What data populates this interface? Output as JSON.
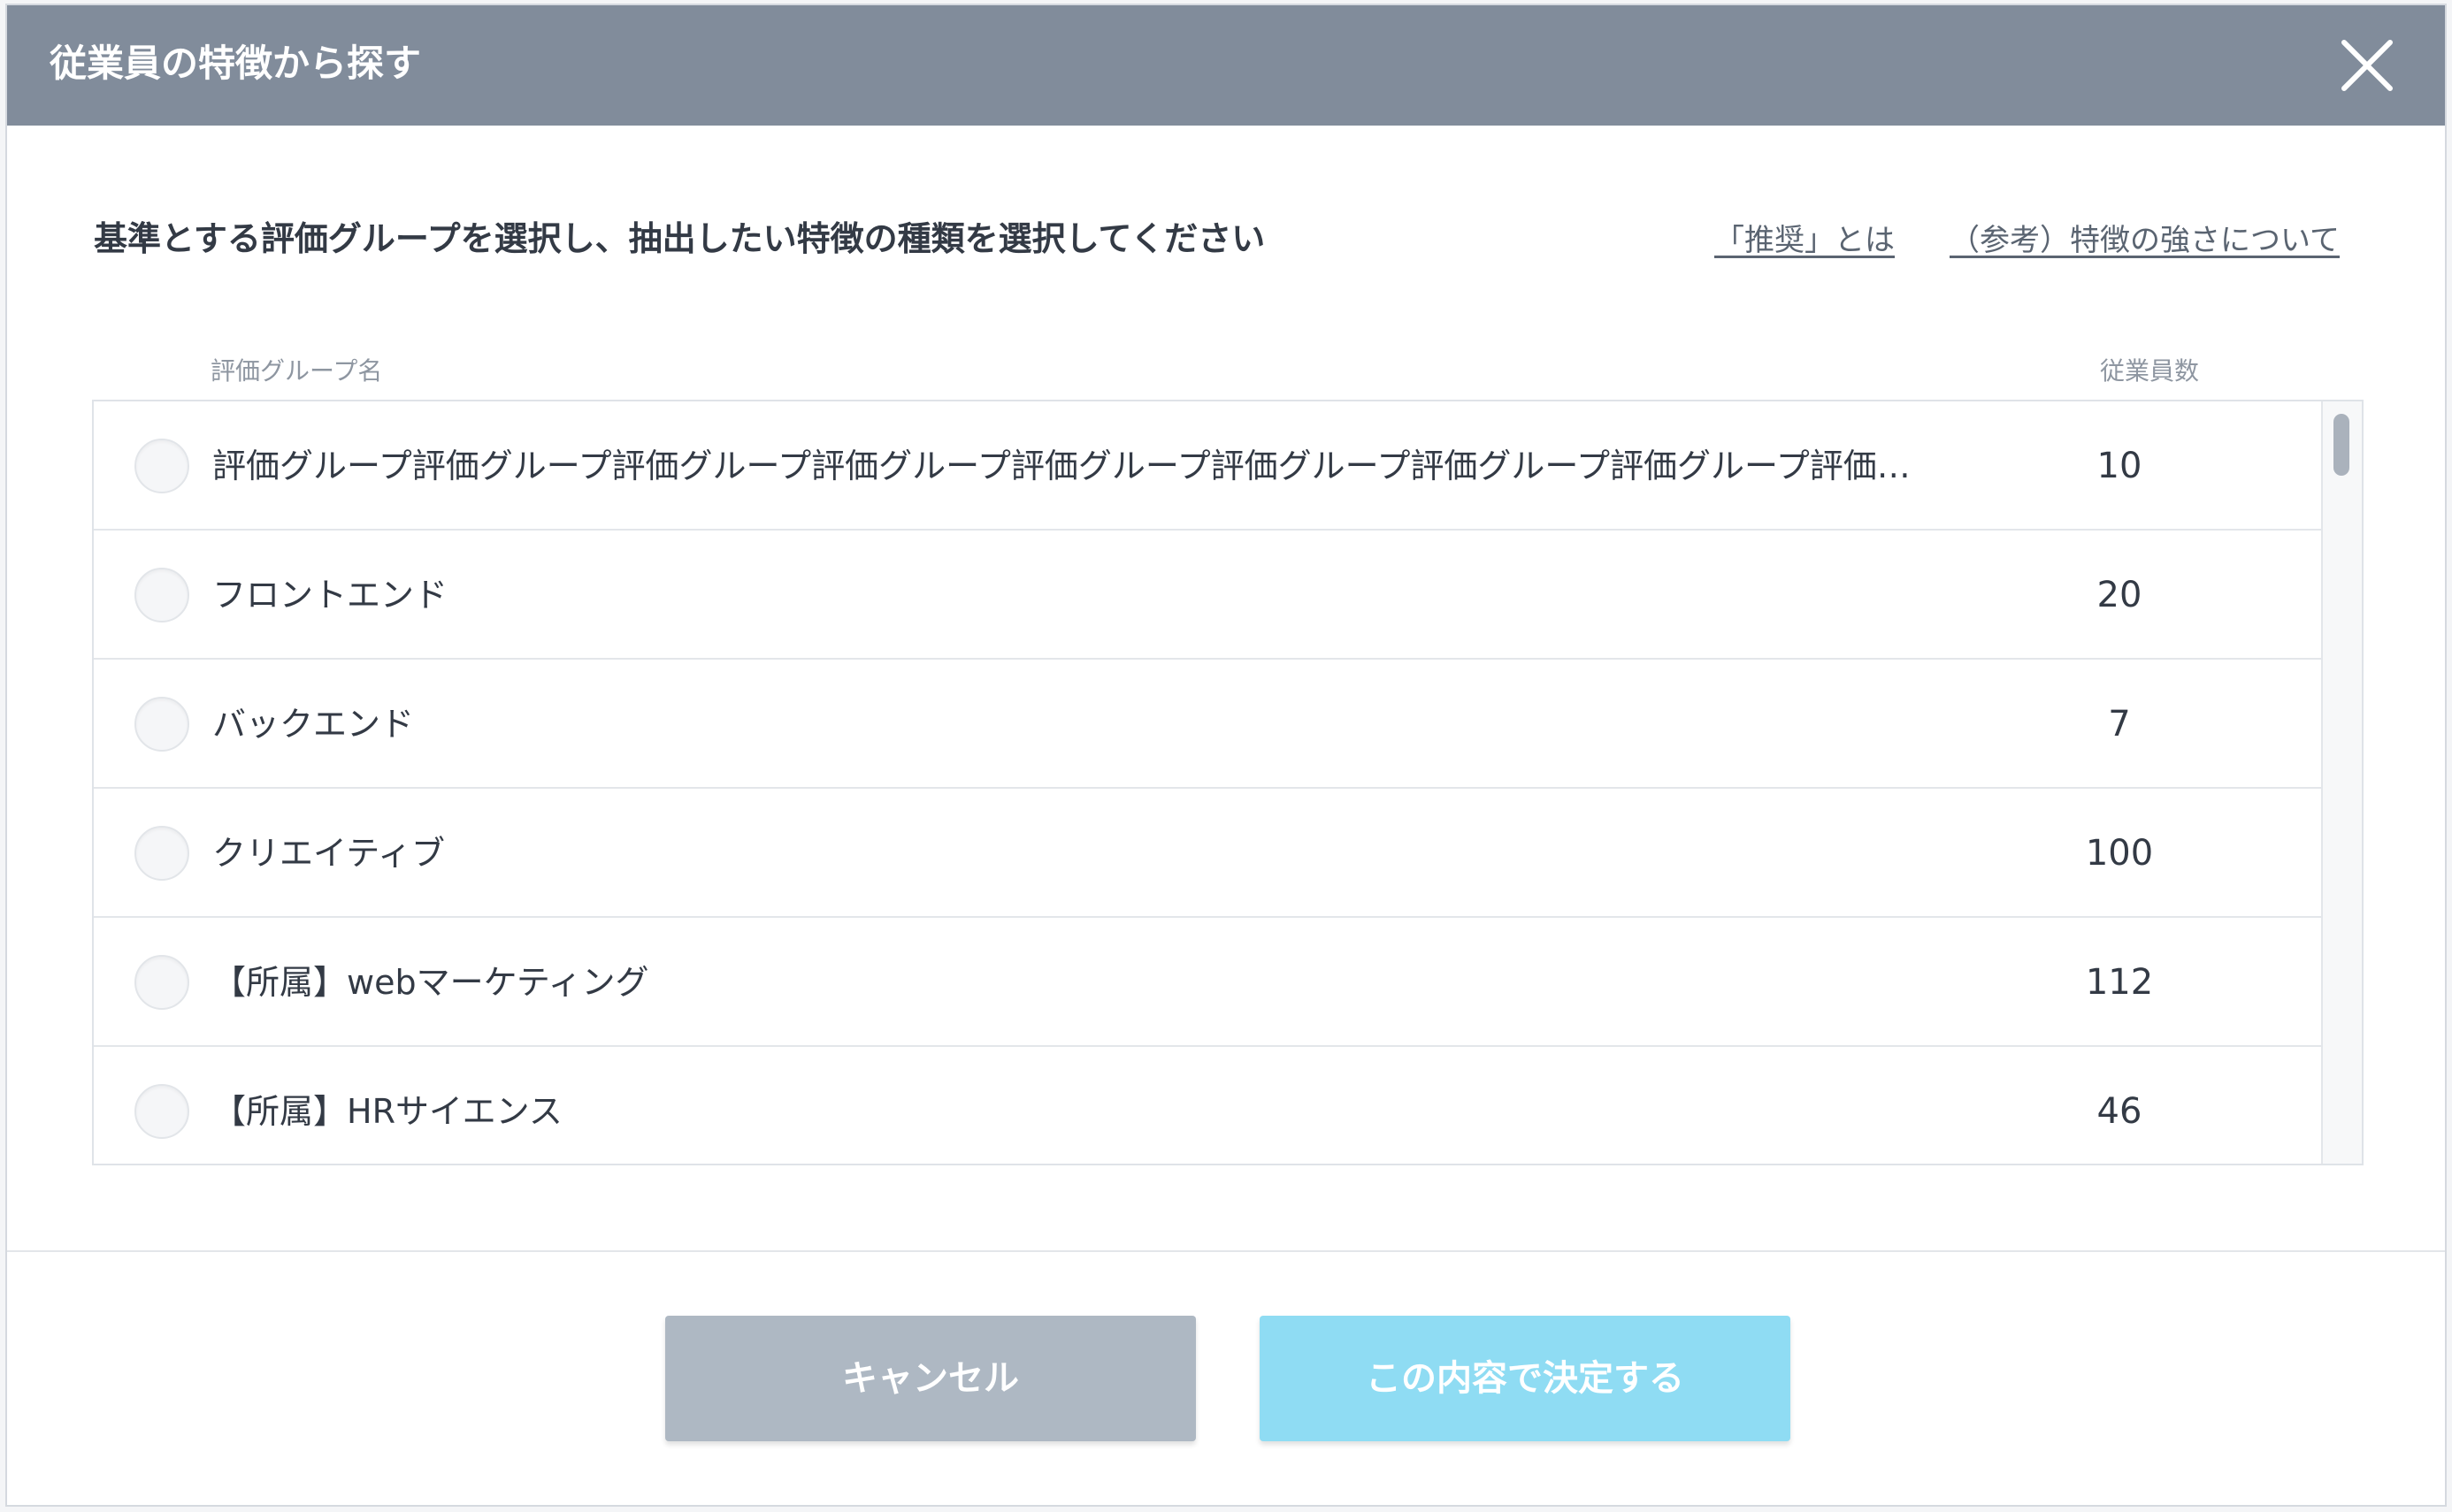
{
  "header": {
    "title": "従業員の特徴から探す",
    "close_icon": "close-icon"
  },
  "instruction": "基準とする評価グループを選択し、抽出したい特徴の種類を選択してください",
  "links": {
    "recommended": "「推奨」とは",
    "reference": "（参考）特徴の強さについて"
  },
  "table": {
    "columns": {
      "name": "評価グループ名",
      "count": "従業員数"
    },
    "rows": [
      {
        "label": "評価グループ評価グループ評価グループ評価グループ評価グループ評価グループ評価グループ評価グループ評価…",
        "count": "10"
      },
      {
        "label": "フロントエンド",
        "count": "20"
      },
      {
        "label": "バックエンド",
        "count": "7"
      },
      {
        "label": "クリエイティブ",
        "count": "100"
      },
      {
        "label": "【所属】webマーケティング",
        "count": "112"
      },
      {
        "label": "【所属】HRサイエンス",
        "count": "46"
      }
    ]
  },
  "footer": {
    "cancel_label": "キャンセル",
    "confirm_label": "この内容で決定する"
  },
  "colors": {
    "header_bg": "#818c9b",
    "cancel_bg": "#aeb8c3",
    "confirm_bg": "#8fdcf3",
    "text": "#333a45"
  }
}
